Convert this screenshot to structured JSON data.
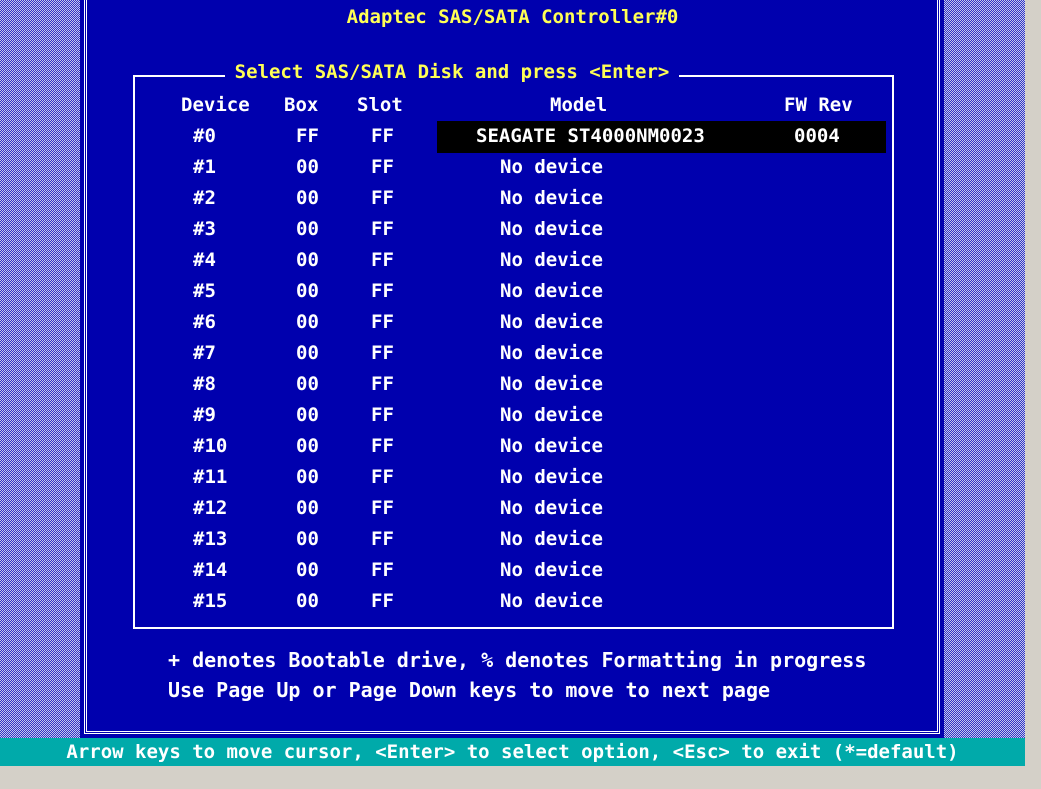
{
  "window": {
    "title": "Adaptec SAS/SATA Controller#0"
  },
  "panel": {
    "title": "Select SAS/SATA Disk and press <Enter>",
    "columns": [
      "Device",
      "Box",
      "Slot",
      "Model",
      "FW Rev"
    ]
  },
  "devices": [
    {
      "device": "#0",
      "box": "FF",
      "slot": "FF",
      "model": "SEAGATE ST4000NM0023",
      "fw": "0004"
    },
    {
      "device": "#1",
      "box": "00",
      "slot": "FF",
      "model": "No device",
      "fw": ""
    },
    {
      "device": "#2",
      "box": "00",
      "slot": "FF",
      "model": "No device",
      "fw": ""
    },
    {
      "device": "#3",
      "box": "00",
      "slot": "FF",
      "model": "No device",
      "fw": ""
    },
    {
      "device": "#4",
      "box": "00",
      "slot": "FF",
      "model": "No device",
      "fw": ""
    },
    {
      "device": "#5",
      "box": "00",
      "slot": "FF",
      "model": "No device",
      "fw": ""
    },
    {
      "device": "#6",
      "box": "00",
      "slot": "FF",
      "model": "No device",
      "fw": ""
    },
    {
      "device": "#7",
      "box": "00",
      "slot": "FF",
      "model": "No device",
      "fw": ""
    },
    {
      "device": "#8",
      "box": "00",
      "slot": "FF",
      "model": "No device",
      "fw": ""
    },
    {
      "device": "#9",
      "box": "00",
      "slot": "FF",
      "model": "No device",
      "fw": ""
    },
    {
      "device": "#10",
      "box": "00",
      "slot": "FF",
      "model": "No device",
      "fw": ""
    },
    {
      "device": "#11",
      "box": "00",
      "slot": "FF",
      "model": "No device",
      "fw": ""
    },
    {
      "device": "#12",
      "box": "00",
      "slot": "FF",
      "model": "No device",
      "fw": ""
    },
    {
      "device": "#13",
      "box": "00",
      "slot": "FF",
      "model": "No device",
      "fw": ""
    },
    {
      "device": "#14",
      "box": "00",
      "slot": "FF",
      "model": "No device",
      "fw": ""
    },
    {
      "device": "#15",
      "box": "00",
      "slot": "FF",
      "model": "No device",
      "fw": ""
    }
  ],
  "footer": {
    "legend": "+ denotes Bootable drive, % denotes Formatting in progress",
    "paging": "Use Page Up or Page Down keys to move to next page"
  },
  "statusbar": {
    "text": "Arrow keys to move cursor, <Enter> to select option, <Esc> to exit (*=default)"
  },
  "colors": {
    "panel_bg": "#0000ae",
    "title_text": "#ffff55",
    "text": "#ffffff",
    "selected_bg": "#000000",
    "statusbar_bg": "#00aaaa"
  }
}
